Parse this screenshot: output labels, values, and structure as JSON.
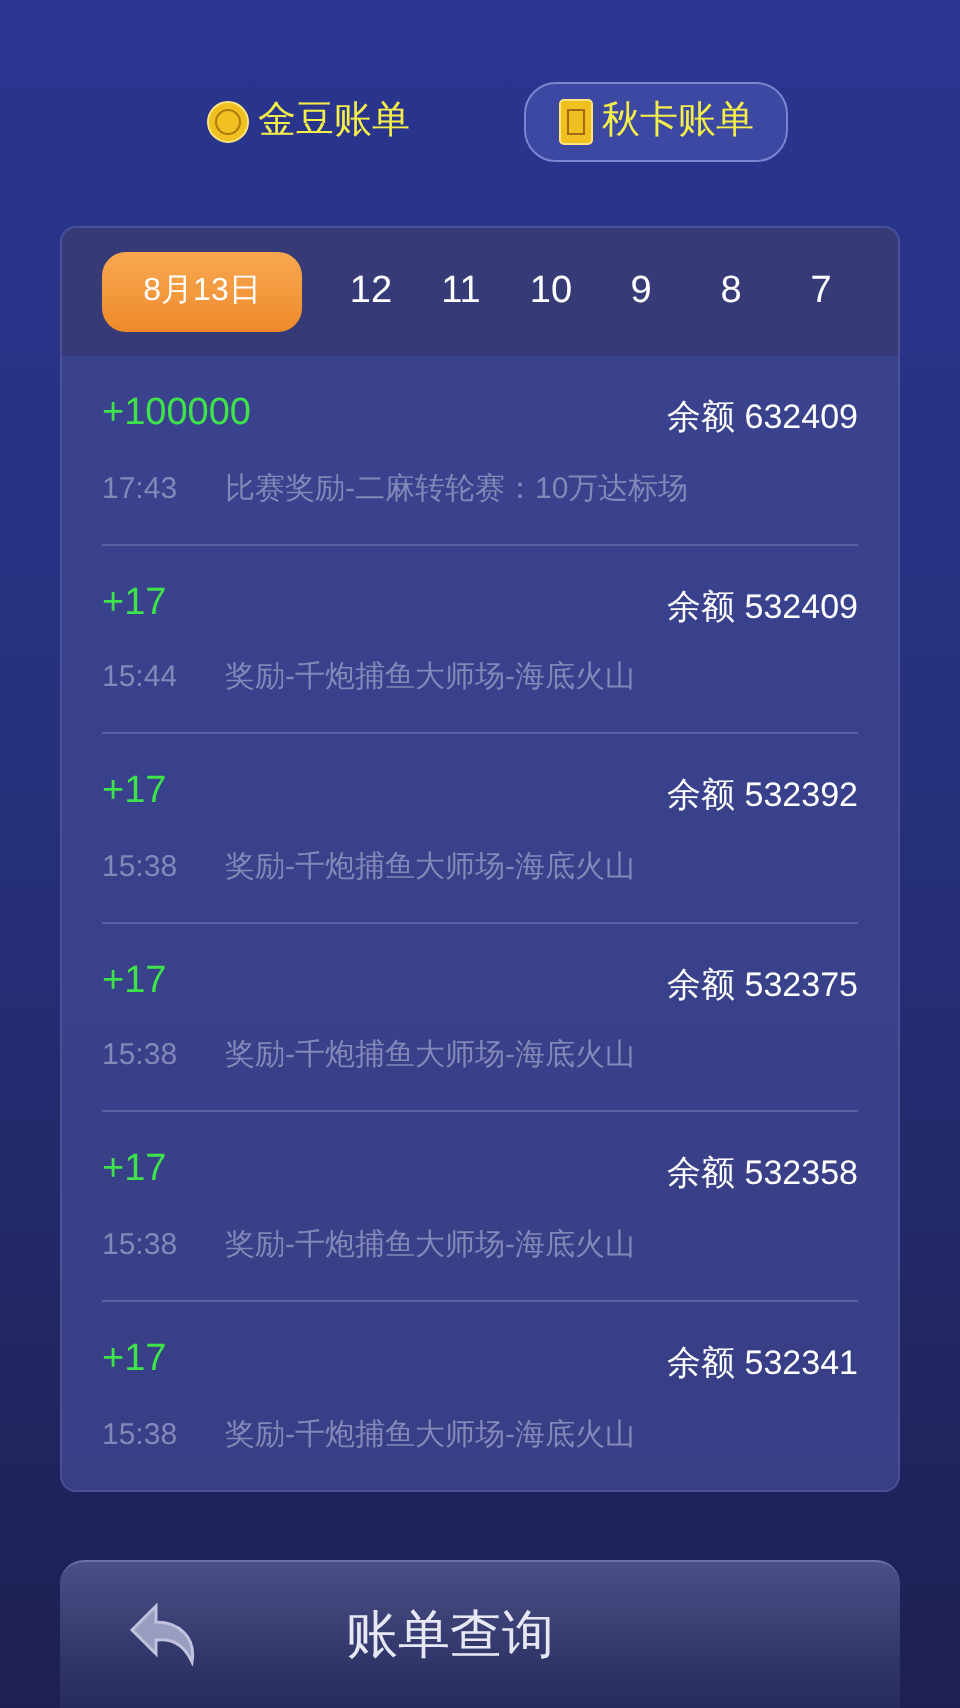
{
  "tabs": [
    {
      "label": "金豆账单",
      "kind": "coin",
      "selected": false
    },
    {
      "label": "秋卡账单",
      "kind": "card",
      "selected": true
    }
  ],
  "dates": [
    {
      "label": "8月13日",
      "selected": true
    },
    {
      "label": "12",
      "selected": false
    },
    {
      "label": "11",
      "selected": false
    },
    {
      "label": "10",
      "selected": false
    },
    {
      "label": "9",
      "selected": false
    },
    {
      "label": "8",
      "selected": false
    },
    {
      "label": "7",
      "selected": false
    }
  ],
  "records": [
    {
      "amount": "+100000",
      "balance": "余额 632409",
      "time": "17:43",
      "description": "比赛奖励-二麻转轮赛：10万达标场"
    },
    {
      "amount": "+17",
      "balance": "余额 532409",
      "time": "15:44",
      "description": "奖励-千炮捕鱼大师场-海底火山"
    },
    {
      "amount": "+17",
      "balance": "余额 532392",
      "time": "15:38",
      "description": "奖励-千炮捕鱼大师场-海底火山"
    },
    {
      "amount": "+17",
      "balance": "余额 532375",
      "time": "15:38",
      "description": "奖励-千炮捕鱼大师场-海底火山"
    },
    {
      "amount": "+17",
      "balance": "余额 532358",
      "time": "15:38",
      "description": "奖励-千炮捕鱼大师场-海底火山"
    },
    {
      "amount": "+17",
      "balance": "余额 532341",
      "time": "15:38",
      "description": "奖励-千炮捕鱼大师场-海底火山"
    }
  ],
  "footer": {
    "title": "账单查询"
  }
}
